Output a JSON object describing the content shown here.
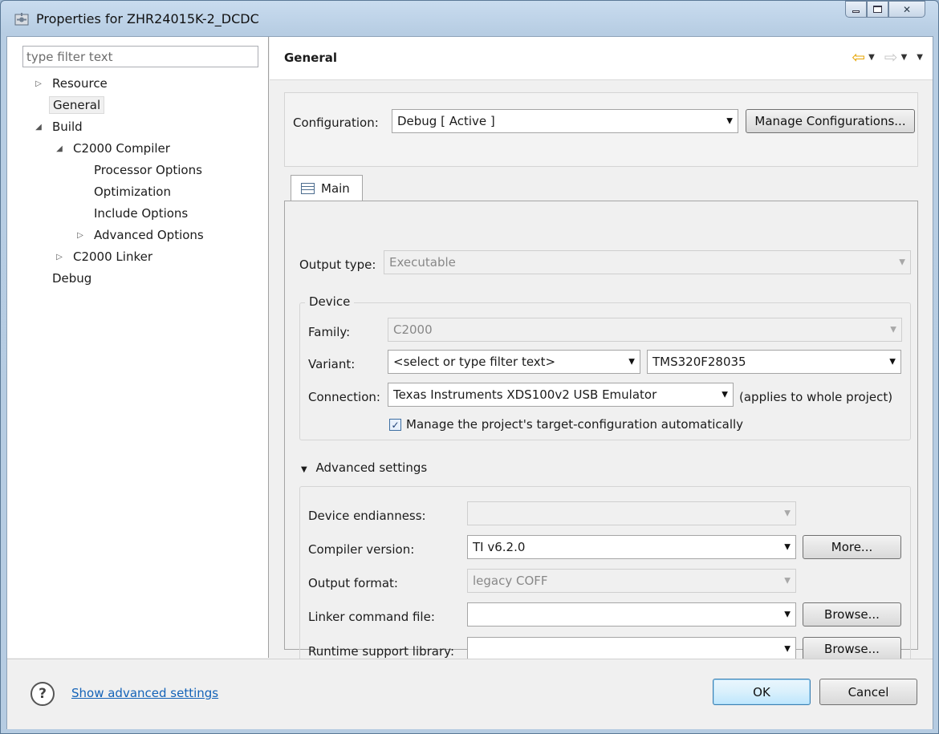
{
  "window": {
    "title": "Properties for ZHR24015K-2_DCDC",
    "close_glyph": "✕"
  },
  "left": {
    "filter_placeholder": "type filter text",
    "tree": [
      {
        "label": "Resource",
        "exp": "▷"
      },
      {
        "label": "General",
        "exp": ""
      },
      {
        "label": "Build",
        "exp": "◢"
      },
      {
        "label": "C2000 Compiler",
        "exp": "◢"
      },
      {
        "label": "Processor Options",
        "exp": ""
      },
      {
        "label": "Optimization",
        "exp": ""
      },
      {
        "label": "Include Options",
        "exp": ""
      },
      {
        "label": "Advanced Options",
        "exp": "▷"
      },
      {
        "label": "C2000 Linker",
        "exp": "▷"
      },
      {
        "label": "Debug",
        "exp": ""
      }
    ]
  },
  "header": {
    "title": "General",
    "back_glyph": "⇦",
    "fwd_glyph": "⇨",
    "dropdown_glyph": "▼"
  },
  "config": {
    "label": "Configuration:",
    "value": "Debug  [ Active ]",
    "manage_button": "Manage Configurations..."
  },
  "tab": {
    "label": "Main"
  },
  "main": {
    "output_type_label": "Output type:",
    "output_type_value": "Executable",
    "device_legend": "Device",
    "family_label": "Family:",
    "family_value": "C2000",
    "variant_label": "Variant:",
    "variant_filter": "<select or type filter text>",
    "variant_value": "TMS320F28035",
    "connection_label": "Connection:",
    "connection_value": "Texas Instruments XDS100v2 USB Emulator",
    "connection_note": "(applies to whole project)",
    "manage_target_label": "Manage the project's target-configuration automatically",
    "manage_target_checked": true,
    "check_glyph": "✓"
  },
  "advanced": {
    "toggle_glyph": "▼",
    "title": "Advanced settings",
    "endianness_label": "Device endianness:",
    "endianness_value": "",
    "compiler_label": "Compiler version:",
    "compiler_value": "TI v6.2.0",
    "more_button": "More...",
    "output_format_label": "Output format:",
    "output_format_value": "legacy COFF",
    "linker_cmd_label": "Linker command file:",
    "linker_cmd_value": "",
    "browse_button_1": "Browse...",
    "runtime_lib_label": "Runtime support library:",
    "runtime_lib_value": "",
    "browse_button_2": "Browse..."
  },
  "footer": {
    "help_glyph": "?",
    "help_link": "Show advanced settings",
    "ok": "OK",
    "cancel": "Cancel"
  },
  "icons": {
    "dropdown_arrow": "▼"
  }
}
